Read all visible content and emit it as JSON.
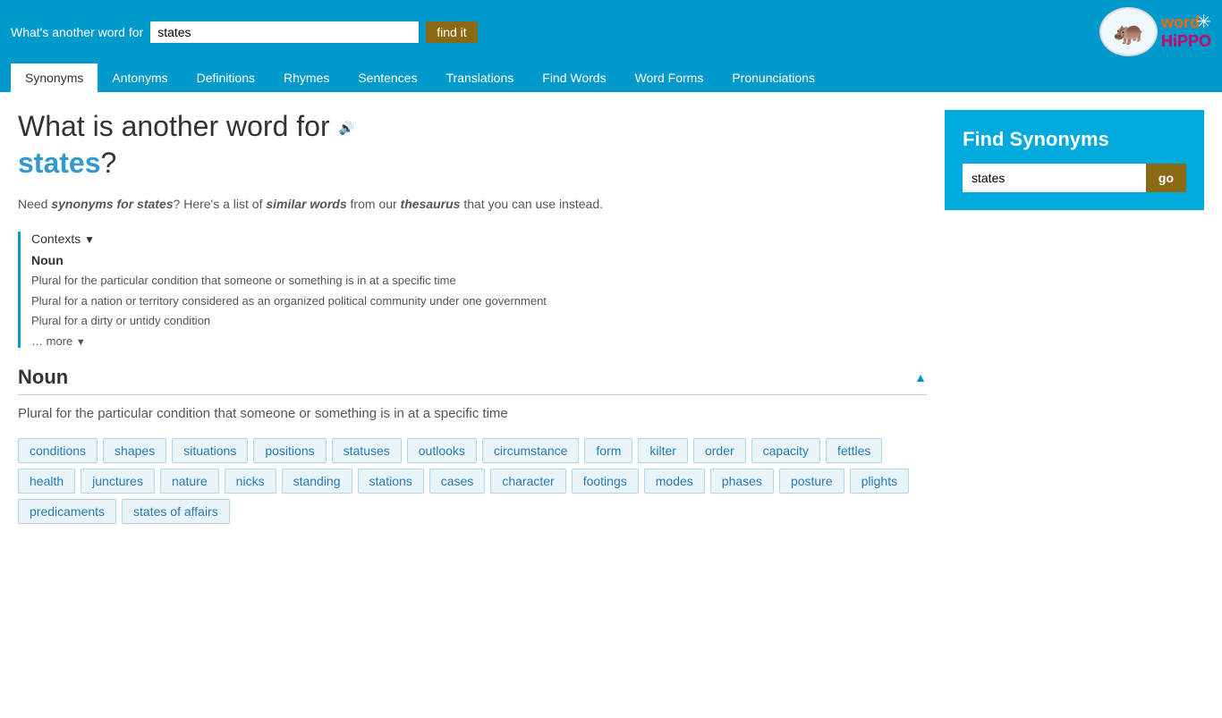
{
  "topbar": {
    "label": "What's another word for",
    "search_value": "states",
    "find_button": "find it"
  },
  "nav": {
    "tabs": [
      {
        "label": "Synonyms",
        "active": true
      },
      {
        "label": "Antonyms",
        "active": false
      },
      {
        "label": "Definitions",
        "active": false
      },
      {
        "label": "Rhymes",
        "active": false
      },
      {
        "label": "Sentences",
        "active": false
      },
      {
        "label": "Translations",
        "active": false
      },
      {
        "label": "Find Words",
        "active": false
      },
      {
        "label": "Word Forms",
        "active": false
      },
      {
        "label": "Pronunciations",
        "active": false
      }
    ]
  },
  "page": {
    "heading_pre": "What is another word for",
    "word": "states",
    "subtitle": "Need synonyms for states? Here's a list of similar words from our thesaurus that you can use instead.",
    "contexts_label": "Contexts",
    "noun_label": "Noun",
    "context_items": [
      "Plural for the particular condition that someone or something is in at a specific time",
      "Plural for a nation or territory considered as an organized political community under one government",
      "Plural for a dirty or untidy condition"
    ],
    "more_label": "… more",
    "section_title": "Noun",
    "section_desc": "Plural for the particular condition that someone or something is in at a specific time",
    "word_tags": [
      "conditions",
      "shapes",
      "situations",
      "positions",
      "statuses",
      "outlooks",
      "circumstance",
      "form",
      "kilter",
      "order",
      "capacity",
      "fettles",
      "health",
      "junctures",
      "nature",
      "nicks",
      "standing",
      "stations",
      "cases",
      "character",
      "footings",
      "modes",
      "phases",
      "posture",
      "plights",
      "predicaments",
      "states of affairs"
    ]
  },
  "sidebar": {
    "find_synonyms_title": "Find Synonyms",
    "input_value": "states",
    "go_button": "go"
  },
  "logo": {
    "word": "word",
    "hippo": "HiPPO"
  },
  "star": "✳"
}
